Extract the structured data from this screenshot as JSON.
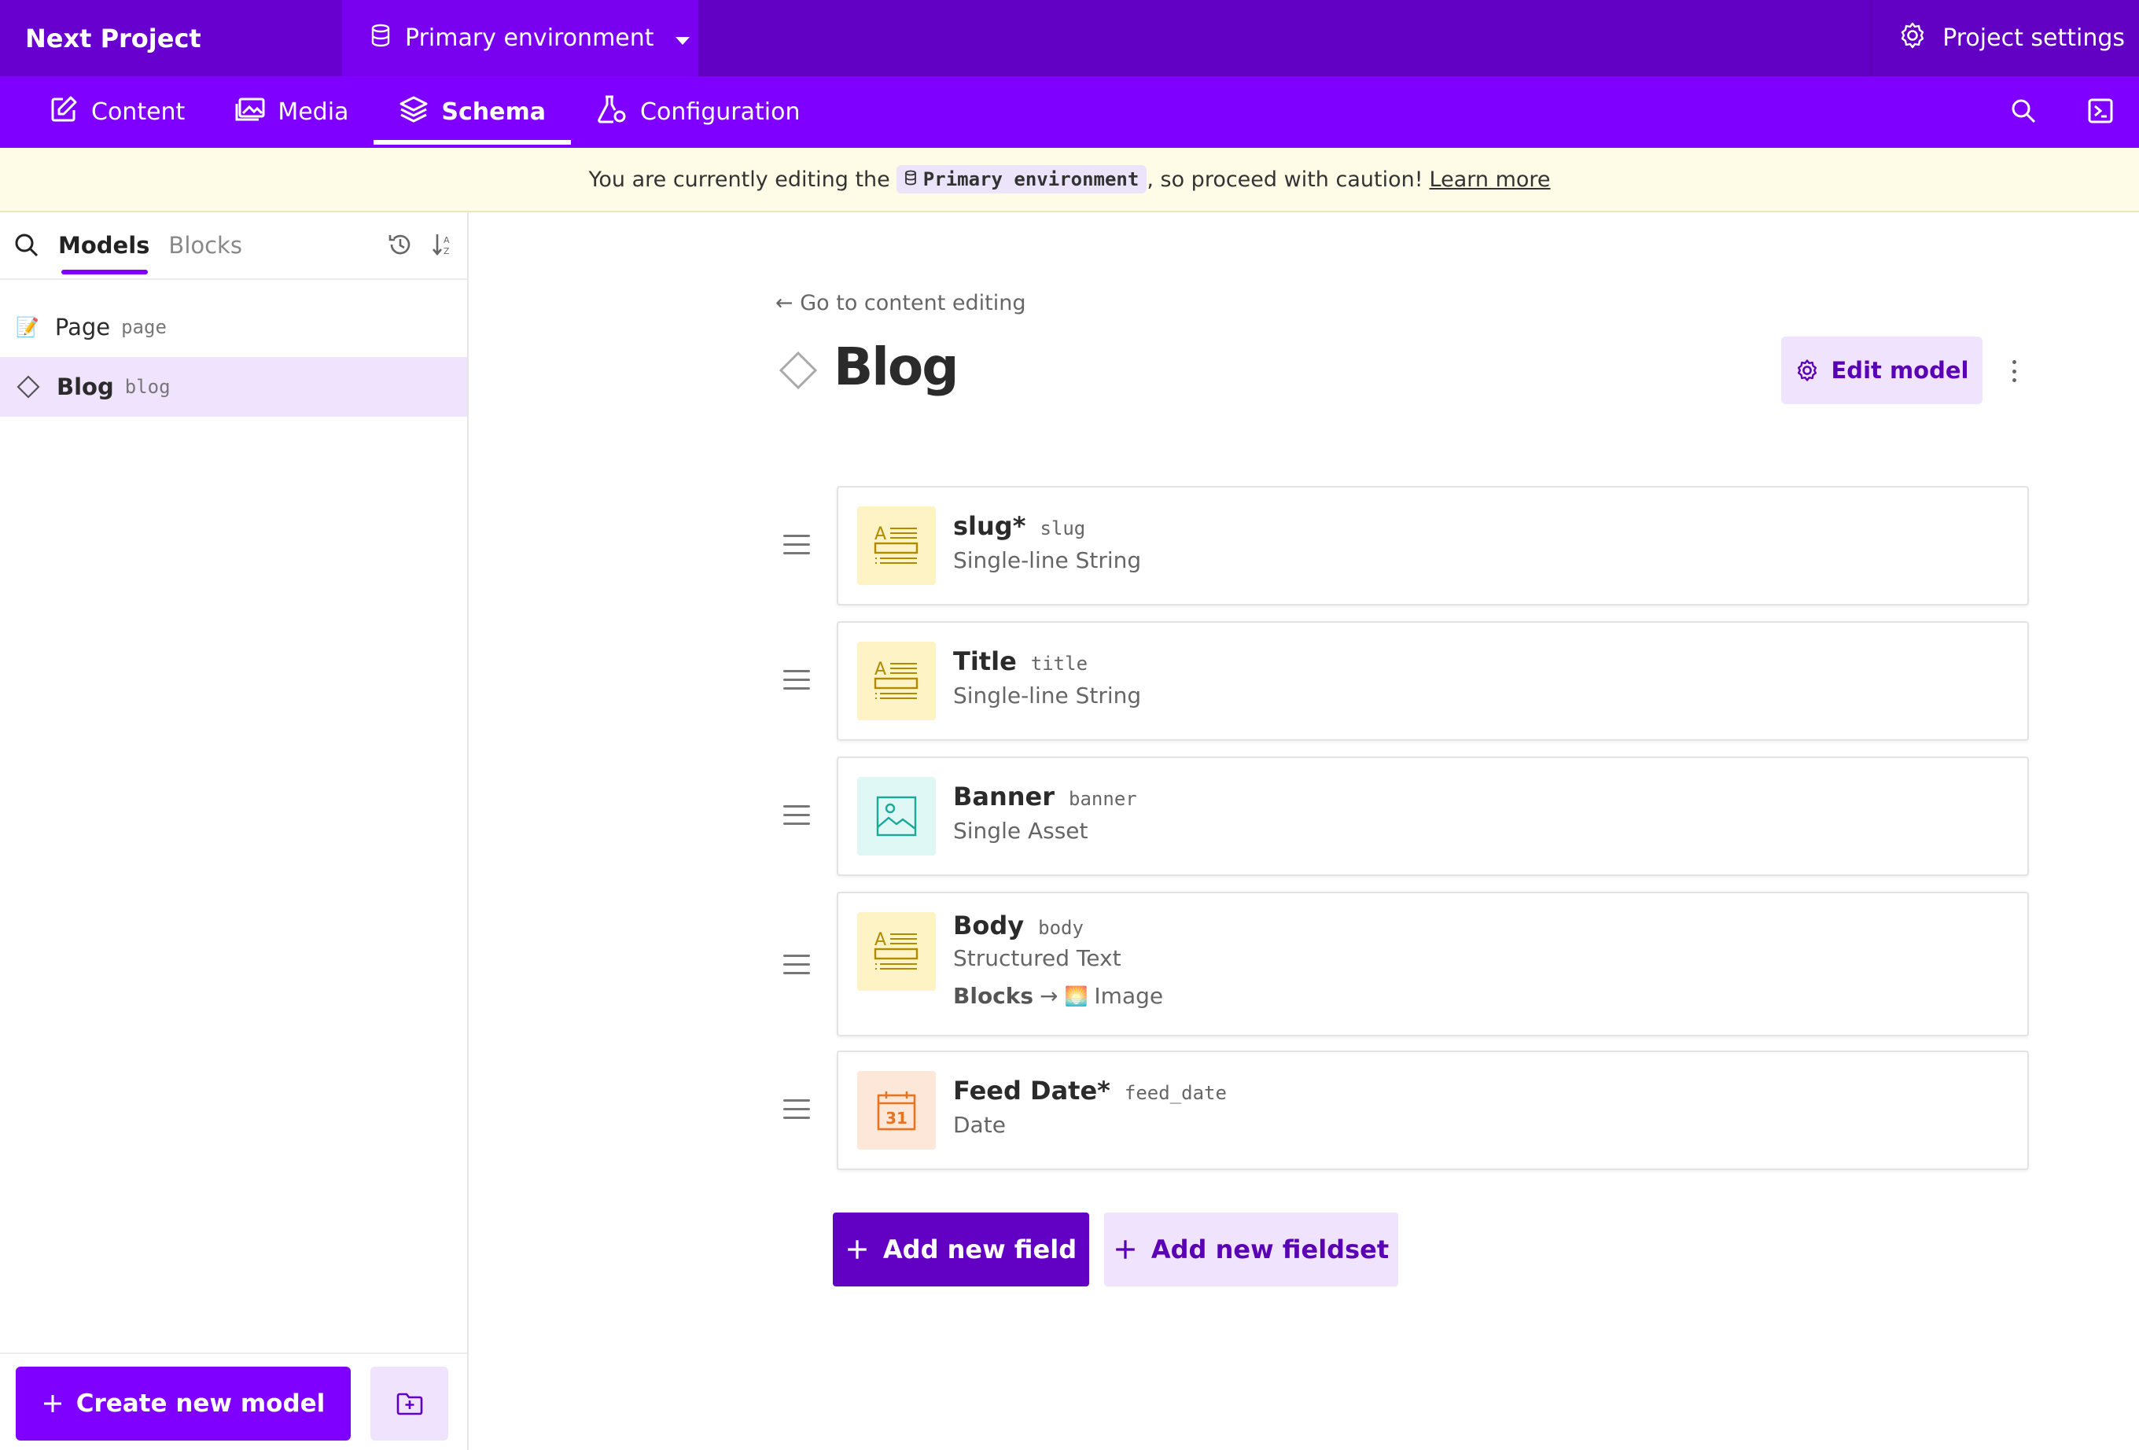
{
  "header": {
    "project_name": "Next Project",
    "environment": "Primary environment",
    "project_settings": "Project settings"
  },
  "nav": {
    "tabs": [
      {
        "label": "Content",
        "icon": "edit-icon"
      },
      {
        "label": "Media",
        "icon": "image-icon"
      },
      {
        "label": "Schema",
        "icon": "layers-icon",
        "active": true
      },
      {
        "label": "Configuration",
        "icon": "flask-gear-icon"
      }
    ]
  },
  "notice": {
    "prefix": "You are currently editing the",
    "env": "Primary environment",
    "suffix": ", so proceed with caution!",
    "link": "Learn more"
  },
  "sidebar": {
    "tabs": [
      "Models",
      "Blocks"
    ],
    "active_tab": "Models",
    "models": [
      {
        "name": "Page",
        "api": "page",
        "icon": "📝"
      },
      {
        "name": "Blog",
        "api": "blog",
        "icon": "diamond-icon",
        "active": true
      }
    ],
    "create_button": "Create new model"
  },
  "main": {
    "back_link": "← Go to content editing",
    "title": "Blog",
    "edit_button": "Edit model",
    "fields": [
      {
        "label": "slug*",
        "api": "slug",
        "type": "Single-line String",
        "icon": "text-field-icon"
      },
      {
        "label": "Title",
        "api": "title",
        "type": "Single-line String",
        "icon": "text-field-icon"
      },
      {
        "label": "Banner",
        "api": "banner",
        "type": "Single Asset",
        "icon": "image-asset-icon"
      },
      {
        "label": "Body",
        "api": "body",
        "type": "Structured Text",
        "icon": "text-field-icon",
        "blocks_label": "Blocks",
        "blocks_arrow": "→",
        "blocks_emoji": "🌅",
        "blocks_value": "Image"
      },
      {
        "label": "Feed Date*",
        "api": "feed_date",
        "type": "Date",
        "icon": "calendar-icon",
        "calendar_day": "31"
      }
    ],
    "add_field": "Add new field",
    "add_fieldset": "Add new fieldset"
  },
  "colors": {
    "brand_dark": "#6200c4",
    "brand": "#7f00ff",
    "brand_light": "#f0e3fe",
    "notice_bg": "#fefbe6"
  }
}
